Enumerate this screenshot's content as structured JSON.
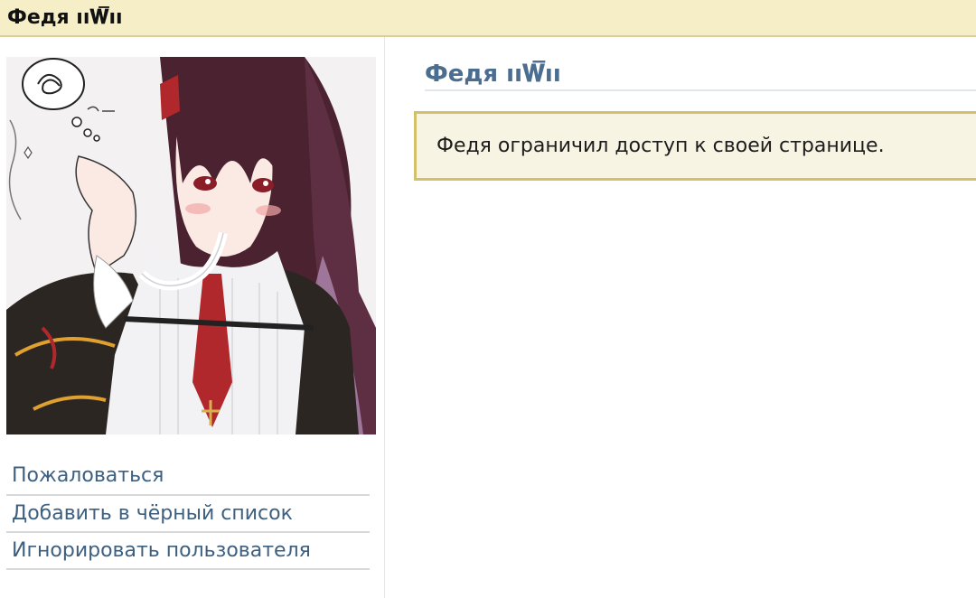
{
  "header": {
    "title": "Федя ıı𝐖̅ıı"
  },
  "profile": {
    "name": "Федя ıı𝐖̅ıı",
    "avatar_icon": "anime-avatar-image",
    "notice": "Федя ограничил доступ к своей странице."
  },
  "actions": [
    {
      "label": "Пожаловаться"
    },
    {
      "label": "Добавить в чёрный список"
    },
    {
      "label": "Игнорировать пользователя"
    }
  ],
  "colors": {
    "header_bg": "#f5eec6",
    "link": "#3d5f80",
    "title": "#4a6d90",
    "notice_bg": "#f8f4e4",
    "notice_border": "#d2c06a"
  }
}
